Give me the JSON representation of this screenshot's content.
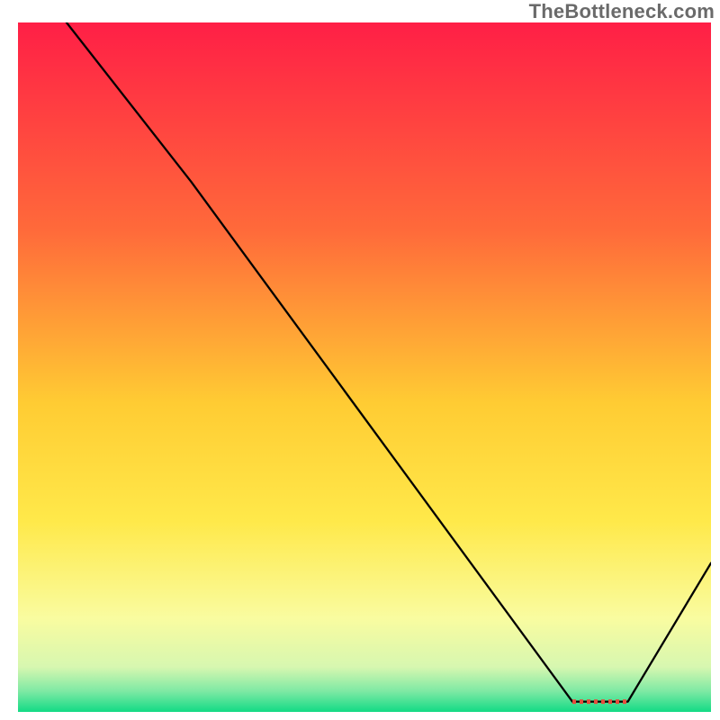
{
  "watermark": "TheBottleneck.com",
  "chart_data": {
    "type": "line",
    "title": "",
    "xlabel": "",
    "ylabel": "",
    "xlim": [
      0,
      100
    ],
    "ylim": [
      0,
      100
    ],
    "grid": false,
    "legend": false,
    "background_gradient": {
      "stops": [
        {
          "offset": 0.0,
          "color": "#ff1f46"
        },
        {
          "offset": 0.3,
          "color": "#ff6a3a"
        },
        {
          "offset": 0.55,
          "color": "#ffcc33"
        },
        {
          "offset": 0.72,
          "color": "#ffe94a"
        },
        {
          "offset": 0.86,
          "color": "#f9fca0"
        },
        {
          "offset": 0.93,
          "color": "#d7f7b0"
        },
        {
          "offset": 0.965,
          "color": "#7ee9a4"
        },
        {
          "offset": 1.0,
          "color": "#00d880"
        }
      ]
    },
    "curve": {
      "x": [
        7,
        25,
        80,
        88,
        100
      ],
      "y": [
        100,
        77,
        2,
        2,
        22
      ],
      "comment": "y=100 is top of plot, y=0 bottom; values estimated from pixel positions"
    },
    "mark": {
      "type": "dashed-segment",
      "color": "#e74c3c",
      "x": [
        80,
        88
      ],
      "y": [
        2,
        2
      ]
    }
  }
}
